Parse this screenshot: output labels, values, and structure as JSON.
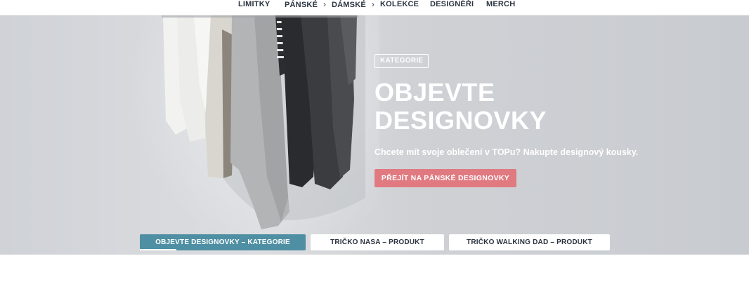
{
  "nav": {
    "items": [
      {
        "label": "LIMITKY",
        "has_chevron": false
      },
      {
        "label": "PÁNSKÉ",
        "has_chevron": true
      },
      {
        "label": "DÁMSKÉ",
        "has_chevron": true
      },
      {
        "label": "KOLEKCE",
        "has_chevron": false
      },
      {
        "label": "DESIGNÉŘI",
        "has_chevron": false
      },
      {
        "label": "MERCH",
        "has_chevron": false
      }
    ],
    "chevron_glyph": "›"
  },
  "hero": {
    "badge": "KATEGORIE",
    "title_line1": "OBJEVTE",
    "title_line2": "DESIGNOVKY",
    "subtitle": "Chcete mít svoje oblečení v TOPu? Nakupte designový kousky.",
    "cta_label": "PŘEJÍT NA PÁNSKÉ DESIGNOVKY"
  },
  "slides": [
    {
      "label": "OBJEVTE DESIGNOVKY – KATEGORIE",
      "active": true,
      "progress": 0.22
    },
    {
      "label": "TRIČKO NASA – PRODUKT",
      "active": false
    },
    {
      "label": "TRIČKO WALKING DAD – PRODUKT",
      "active": false
    }
  ],
  "colors": {
    "accent_teal": "#4f8fa3",
    "cta_pink": "#e07a80",
    "nav_text": "#2b3440"
  }
}
